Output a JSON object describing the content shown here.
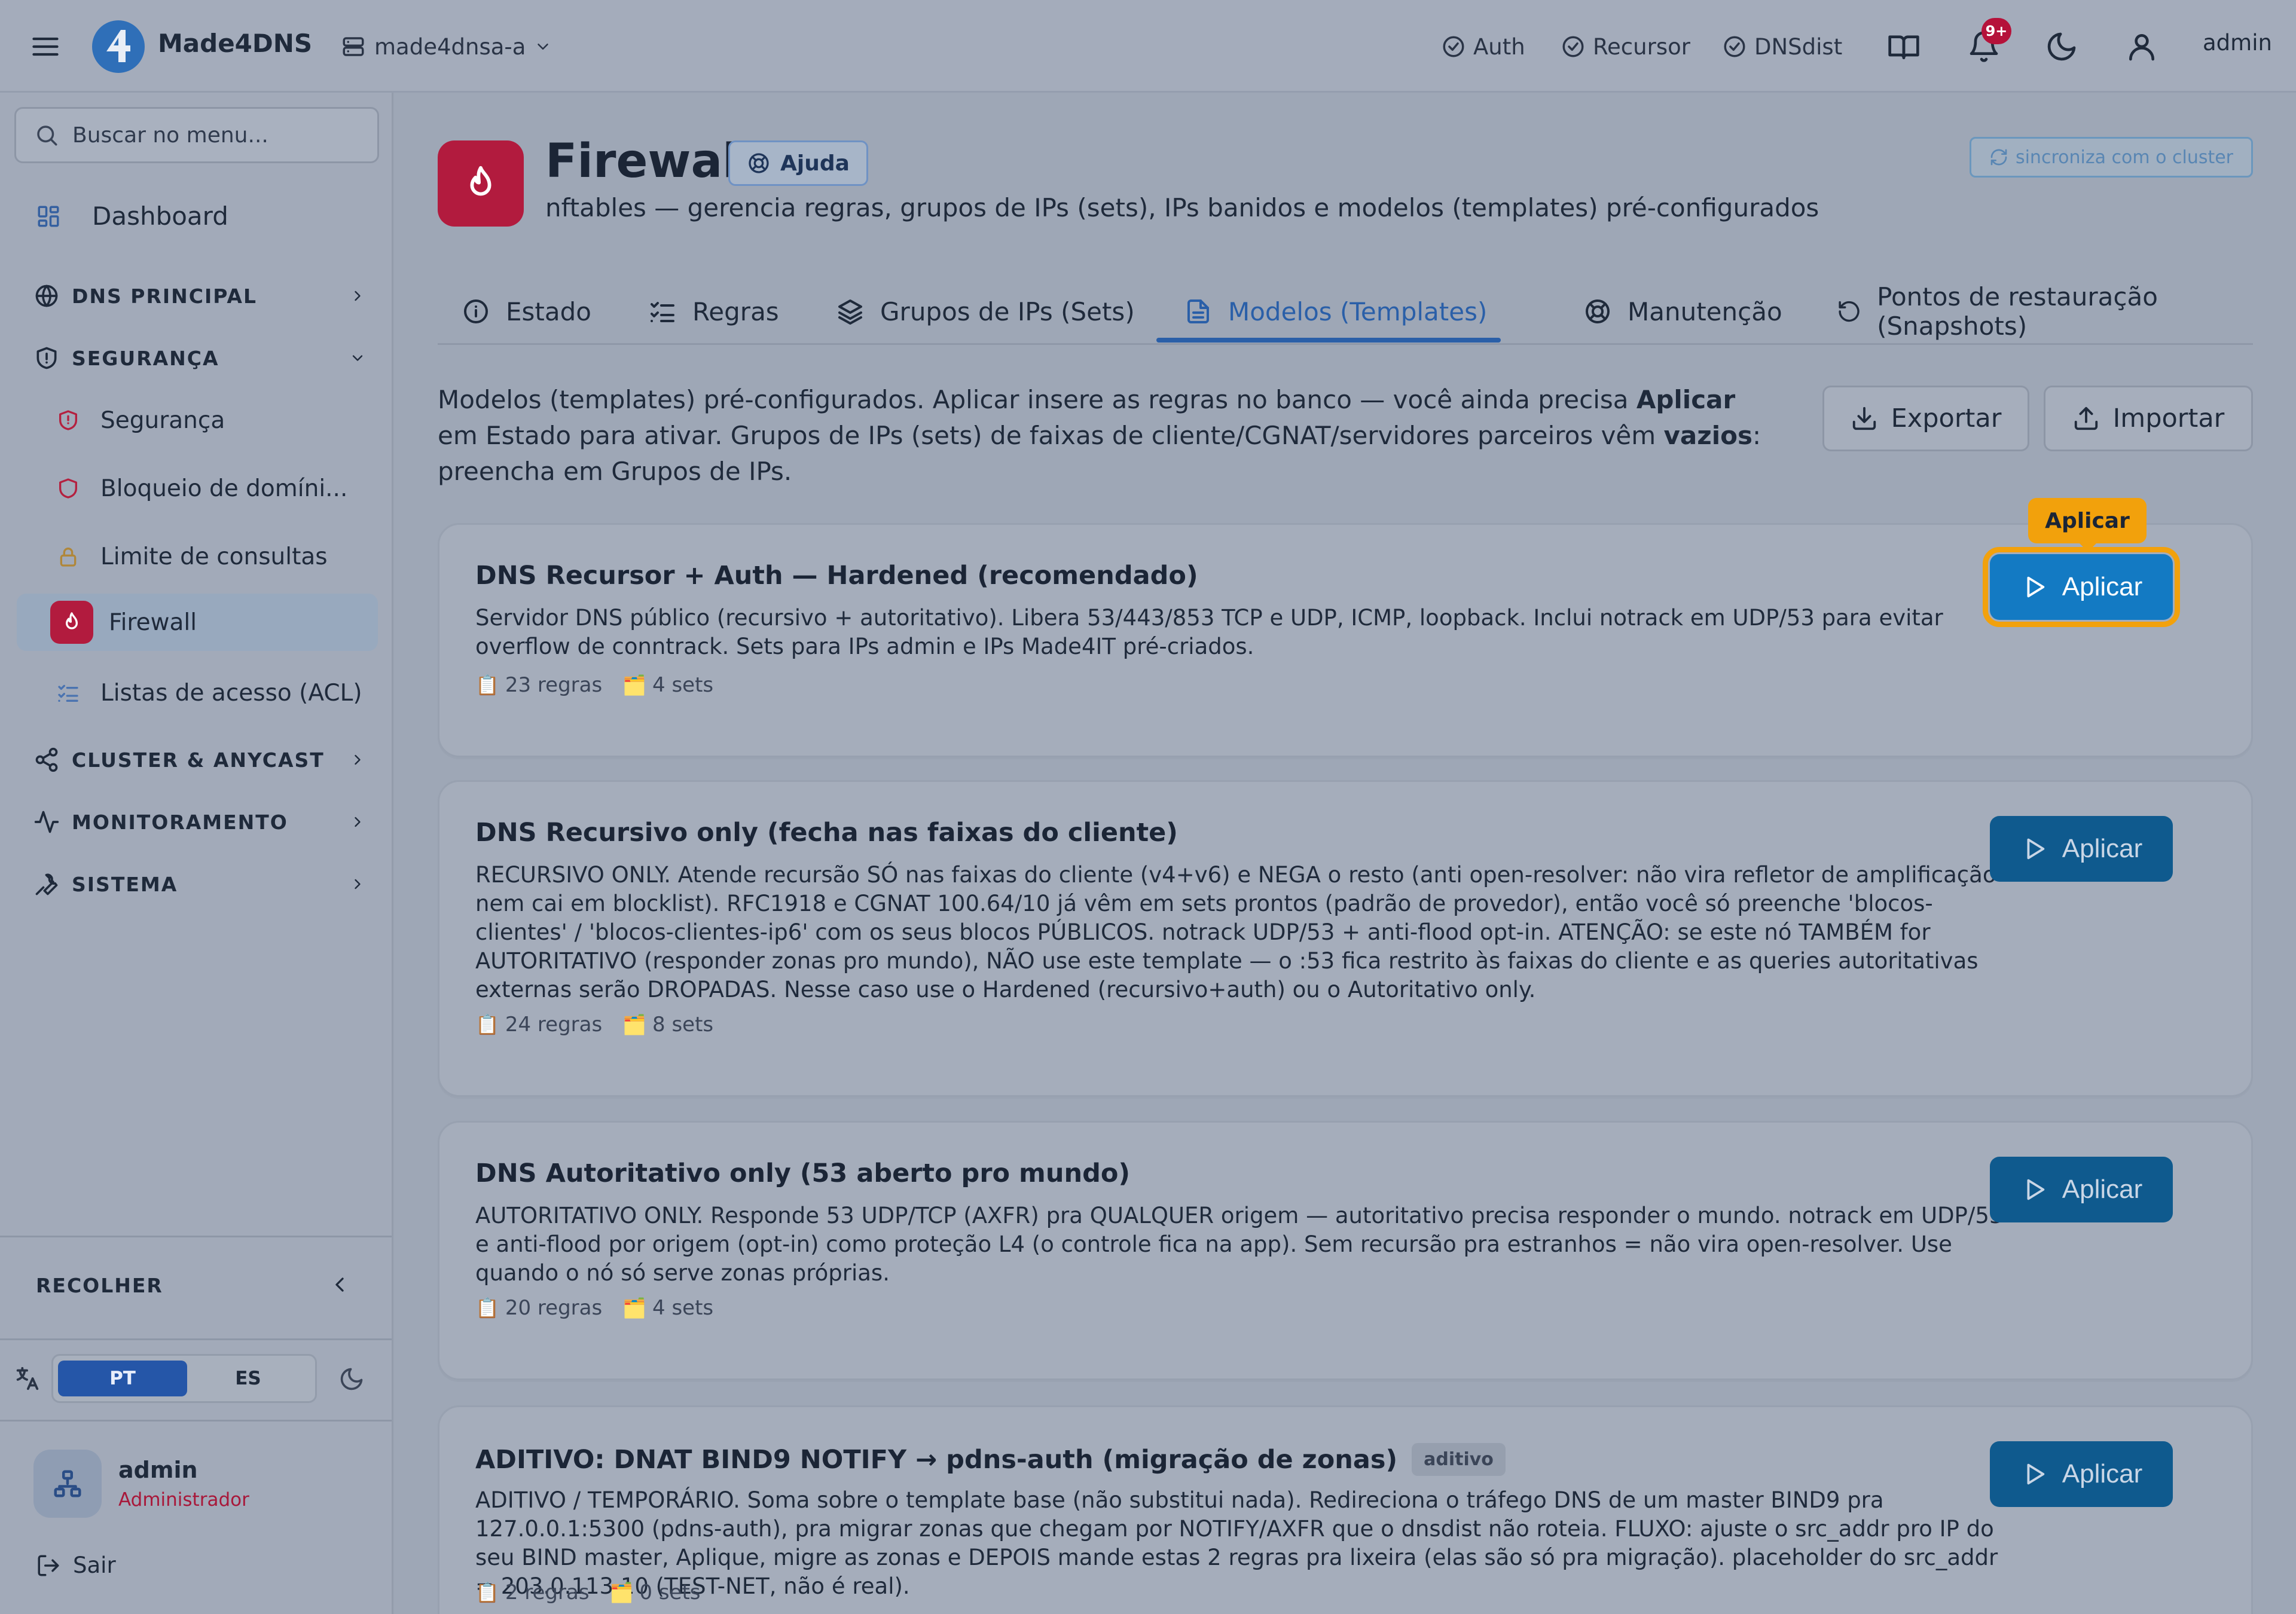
{
  "topbar": {
    "brand": "Made4DNS",
    "server": "made4dnsa-a",
    "services": [
      {
        "label": "Auth"
      },
      {
        "label": "Recursor"
      },
      {
        "label": "DNSdist"
      }
    ],
    "notif_count": "9+",
    "user": "admin"
  },
  "sidebar": {
    "search_placeholder": "Buscar no menu...",
    "dashboard": "Dashboard",
    "sections": {
      "dns_principal": "DNS PRINCIPAL",
      "seguranca": "SEGURANÇA",
      "cluster": "CLUSTER & ANYCAST",
      "monitoramento": "MONITORAMENTO",
      "sistema": "SISTEMA"
    },
    "security_items": [
      {
        "label": "Segurança"
      },
      {
        "label": "Bloqueio de domíni..."
      },
      {
        "label": "Limite de consultas"
      },
      {
        "label": "Firewall"
      },
      {
        "label": "Listas de acesso (ACL)"
      }
    ],
    "collapse": "RECOLHER",
    "lang": {
      "pt": "PT",
      "es": "ES"
    },
    "user_name": "admin",
    "user_role": "Administrador",
    "logout": "Sair"
  },
  "page": {
    "title": "Firewall",
    "help": "Ajuda",
    "subtitle": "nftables — gerencia regras, grupos de IPs (sets), IPs banidos e modelos (templates) pré-configurados",
    "sync": "sincroniza com o cluster",
    "tabs": [
      {
        "label": "Estado"
      },
      {
        "label": "Regras"
      },
      {
        "label": "Grupos de IPs (Sets)"
      },
      {
        "label": "Modelos (Templates)"
      },
      {
        "label": "Manutenção"
      },
      {
        "label": "Pontos de restauração (Snapshots)"
      }
    ],
    "active_tab": "Modelos (Templates)",
    "intro": {
      "p1": "Modelos (templates) pré-configurados. Aplicar insere as regras no banco — você ainda precisa ",
      "b1": "Aplicar",
      "p2": " em Estado para ativar. Grupos de IPs (sets) de faixas de cliente/CGNAT/servidores parceiros vêm ",
      "b2": "vazios",
      "p3": ": preencha em Grupos de IPs."
    },
    "export": "Exportar",
    "import": "Importar",
    "tooltip": "Aplicar"
  },
  "templates": [
    {
      "title": "DNS Recursor + Auth — Hardened (recomendado)",
      "desc": "Servidor DNS público (recursivo + autoritativo). Libera 53/443/853 TCP e UDP, ICMP, loopback. Inclui notrack em UDP/53 para evitar overflow de conntrack. Sets para IPs admin e IPs Made4IT pré-criados.",
      "rules": "23 regras",
      "sets": "4 sets",
      "apply": "Aplicar"
    },
    {
      "title": "DNS Recursivo only (fecha nas faixas do cliente)",
      "desc": "RECURSIVO ONLY. Atende recursão SÓ nas faixas do cliente (v4+v6) e NEGA o resto (anti open-resolver: não vira refletor de amplificação nem cai em blocklist). RFC1918 e CGNAT 100.64/10 já vêm em sets prontos (padrão de provedor), então você só preenche 'blocos-clientes' / 'blocos-clientes-ip6' com os seus blocos PÚBLICOS. notrack UDP/53 + anti-flood opt-in. ATENÇÃO: se este nó TAMBÉM for AUTORITATIVO (responder zonas pro mundo), NÃO use este template — o :53 fica restrito às faixas do cliente e as queries autoritativas externas serão DROPADAS. Nesse caso use o Hardened (recursivo+auth) ou o Autoritativo only.",
      "rules": "24 regras",
      "sets": "8 sets",
      "apply": "Aplicar"
    },
    {
      "title": "DNS Autoritativo only (53 aberto pro mundo)",
      "desc": "AUTORITATIVO ONLY. Responde 53 UDP/TCP (AXFR) pra QUALQUER origem — autoritativo precisa responder o mundo. notrack em UDP/53 e anti-flood por origem (opt-in) como proteção L4 (o controle fica na app). Sem recursão pra estranhos = não vira open-resolver. Use quando o nó só serve zonas próprias.",
      "rules": "20 regras",
      "sets": "4 sets",
      "apply": "Aplicar"
    },
    {
      "title": "ADITIVO: DNAT BIND9 NOTIFY → pdns-auth (migração de zonas)",
      "badge": "aditivo",
      "desc": "ADITIVO / TEMPORÁRIO. Soma sobre o template base (não substitui nada). Redireciona o tráfego DNS de um master BIND9 pra 127.0.0.1:5300 (pdns-auth), pra migrar zonas que chegam por NOTIFY/AXFR que o dnsdist não roteia. FLUXO: ajuste o src_addr pro IP do seu BIND master, Aplique, migre as zonas e DEPOIS mande estas 2 regras pra lixeira (elas são só pra migração). placeholder do src_addr = 203.0.113.10 (TEST-NET, não é real).",
      "rules": "2 regras",
      "sets": "0 sets",
      "apply": "Aplicar"
    }
  ]
}
